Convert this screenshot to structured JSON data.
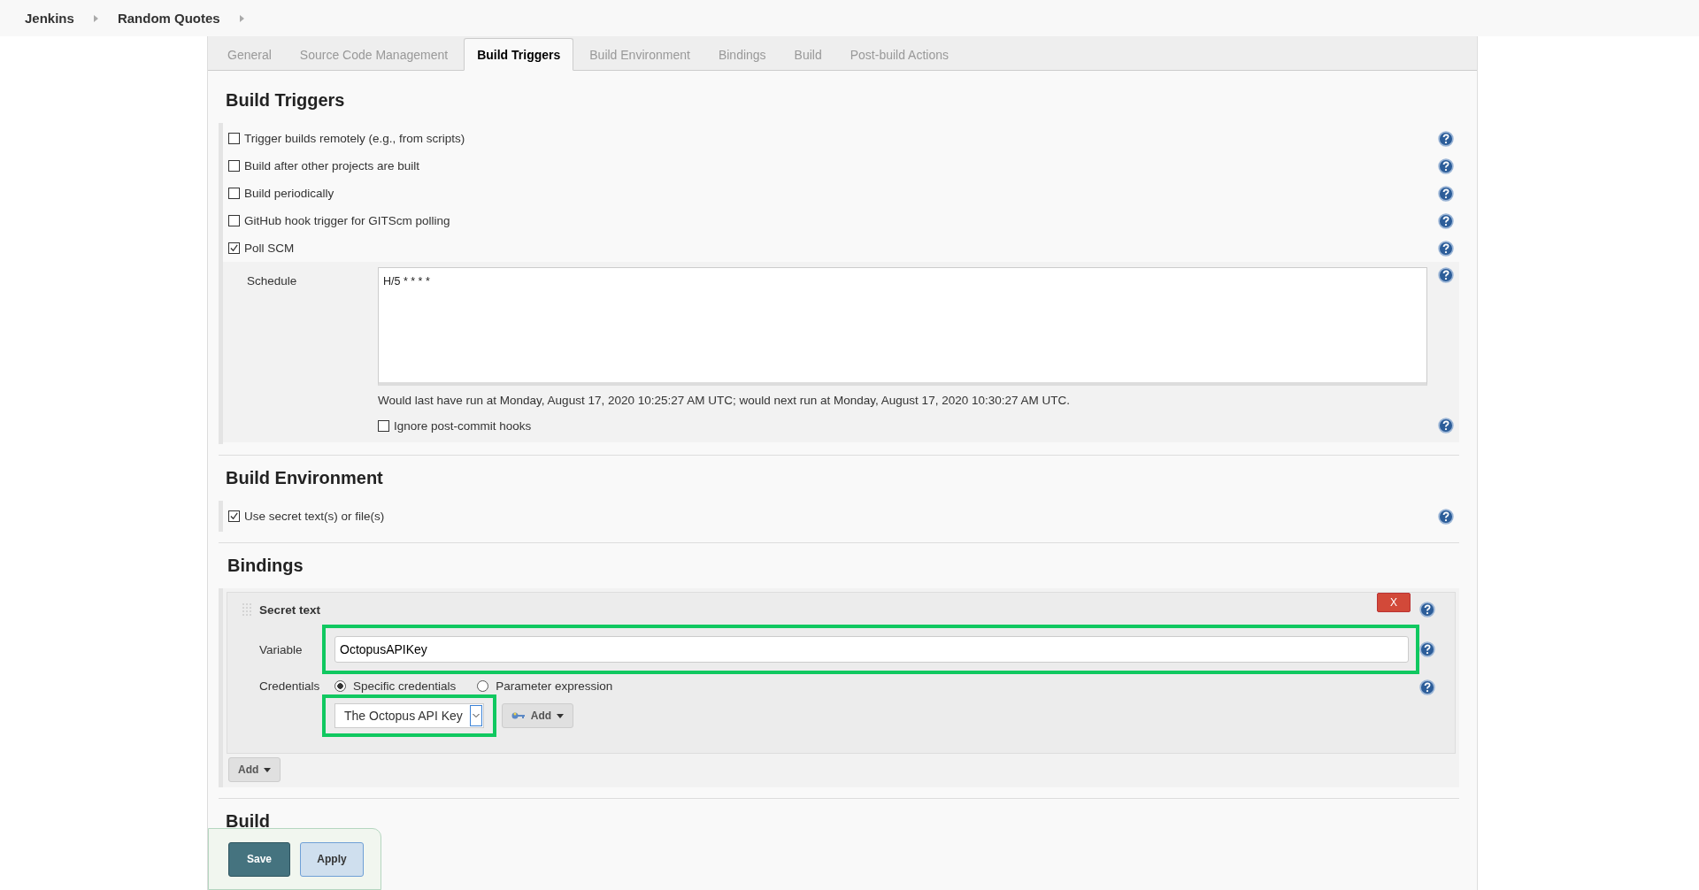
{
  "breadcrumbs": [
    {
      "label": "Jenkins"
    },
    {
      "label": "Random Quotes"
    }
  ],
  "tabs": [
    {
      "label": "General",
      "selected": false
    },
    {
      "label": "Source Code Management",
      "selected": false
    },
    {
      "label": "Build Triggers",
      "selected": true
    },
    {
      "label": "Build Environment",
      "selected": false
    },
    {
      "label": "Bindings",
      "selected": false
    },
    {
      "label": "Build",
      "selected": false
    },
    {
      "label": "Post-build Actions",
      "selected": false
    }
  ],
  "build_triggers": {
    "title": "Build Triggers",
    "options": [
      {
        "label": "Trigger builds remotely (e.g., from scripts)",
        "checked": false
      },
      {
        "label": "Build after other projects are built",
        "checked": false
      },
      {
        "label": "Build periodically",
        "checked": false
      },
      {
        "label": "GitHub hook trigger for GITScm polling",
        "checked": false
      },
      {
        "label": "Poll SCM",
        "checked": true
      }
    ],
    "schedule": {
      "label": "Schedule",
      "value": "H/5 * * * *",
      "note": "Would last have run at Monday, August 17, 2020 10:25:27 AM UTC; would next run at Monday, August 17, 2020 10:30:27 AM UTC.",
      "ignore_hooks": {
        "label": "Ignore post-commit hooks",
        "checked": false
      }
    }
  },
  "build_environment": {
    "title": "Build Environment",
    "options": [
      {
        "label": "Use secret text(s) or file(s)",
        "checked": true
      }
    ]
  },
  "bindings": {
    "title": "Bindings",
    "binding": {
      "title": "Secret text",
      "delete": "X",
      "variable": {
        "label": "Variable",
        "value": "OctopusAPIKey"
      },
      "credentials": {
        "label": "Credentials",
        "modes": [
          {
            "label": "Specific credentials",
            "selected": true
          },
          {
            "label": "Parameter expression",
            "selected": false
          }
        ],
        "value": "The Octopus API Key",
        "add": "Add"
      }
    },
    "add": "Add"
  },
  "build": {
    "title": "Build"
  },
  "actions": [
    {
      "label": "Save",
      "kind": "primary"
    },
    {
      "label": "Apply",
      "kind": "secondary"
    }
  ]
}
